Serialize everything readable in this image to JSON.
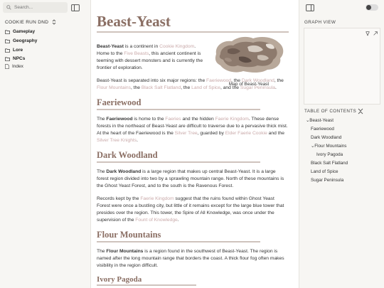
{
  "sidebar": {
    "search_placeholder": "Search...",
    "vault_name": "COOKIE RUN DND",
    "items": [
      {
        "label": "Gameplay",
        "type": "folder"
      },
      {
        "label": "Geography",
        "type": "folder"
      },
      {
        "label": "Lore",
        "type": "folder"
      },
      {
        "label": "NPCs",
        "type": "folder"
      },
      {
        "label": "Index",
        "type": "file"
      }
    ]
  },
  "article": {
    "title": "Beast-Yeast",
    "map_caption": "Map of Beast-Yeast",
    "intro": {
      "bold": "Beast-Yeast",
      "t1": " is a continent in ",
      "l1": "Cookie Kingdom",
      "t2": ". Home to the ",
      "l2": "Five Beasts",
      "t3": ", this ancient continent is teeming with dessert monsters and is currently the frontier of exploration."
    },
    "regions": {
      "t1": "Beast-Yeast is separated into six major regions: the ",
      "l1": "Faeriewood",
      "t2": ", the ",
      "l2": "Dark Woodland",
      "t3": ", the ",
      "l3": "Flour Mountains",
      "t4": ", the ",
      "l4": "Black Salt Flatland",
      "t5": ", the ",
      "l5": "Land of Spice",
      "t6": ", and the ",
      "l6": "Sugar Peninsula",
      "t7": "."
    },
    "faeriewood": {
      "heading": "Faeriewood",
      "t1": "The ",
      "bold": "Faeriewood",
      "t2": " is home to the ",
      "l1": "Faeries",
      "t3": " and the hidden ",
      "l2": "Faerie Kingdom",
      "t4": ". These dense forests in the northeast of Beast-Yeast are difficult to traverse due to a pervasive thick mist. At the heart of the Faeriewood is the ",
      "l3": "Silver Tree",
      "t5": ", guarded by ",
      "l4": "Elder Faerie Cookie",
      "t6": " and the ",
      "l5": "Silver Tree Knights",
      "t7": "."
    },
    "dark_woodland": {
      "heading": "Dark Woodland",
      "t1": "The ",
      "bold": "Dark Woodland",
      "t2": " is a large region that makes up central Beast-Yeast. It is a large forest region divided into two by a sprawling mountain range. North of these mountains is the Ghost Yeast Forest, and to the south is the Ravenous Forest.",
      "r1": "Records kept by the ",
      "rl1": "Faerie Kingdom",
      "r2": " suggest that the ruins found within Ghost Yeast Forest were once a bustling city, but little of it remains except for the large blue tower that presides over the region. This tower, the Spire of All Knowledge, was once under the supervision of the ",
      "rl2": "Fount of Knowledge",
      "r3": "."
    },
    "flour_mountains": {
      "heading": "Flour Mountains",
      "t1": "The ",
      "bold": "Flour Mountains",
      "t2": " is a region found in the southwest of Beast-Yeast. The region is named after the long mountain range that borders the coast. A thick flour fog often makes visibility in the region difficult."
    },
    "ivory_pagoda": {
      "heading": "Ivory Pagoda"
    }
  },
  "right_panel": {
    "graph_title": "GRAPH VIEW",
    "toc_title": "TABLE OF CONTENTS",
    "toc": [
      {
        "label": "Beast-Yeast",
        "level": 0,
        "collapsible": true
      },
      {
        "label": "Faeriewood",
        "level": 1,
        "collapsible": false
      },
      {
        "label": "Dark Woodland",
        "level": 1,
        "collapsible": false
      },
      {
        "label": "Flour Mountains",
        "level": 1,
        "collapsible": true
      },
      {
        "label": "Ivory Pagoda",
        "level": 2,
        "collapsible": false
      },
      {
        "label": "Black Salt Flatland",
        "level": 1,
        "collapsible": false
      },
      {
        "label": "Land of Spice",
        "level": 1,
        "collapsible": false
      },
      {
        "label": "Sugar Peninsula",
        "level": 1,
        "collapsible": false
      }
    ]
  },
  "colors": {
    "heading": "#8a6e63",
    "link": "#c9a9a9",
    "rule": "#cfc3bd",
    "sidebar_bg": "#f7f6f3"
  }
}
